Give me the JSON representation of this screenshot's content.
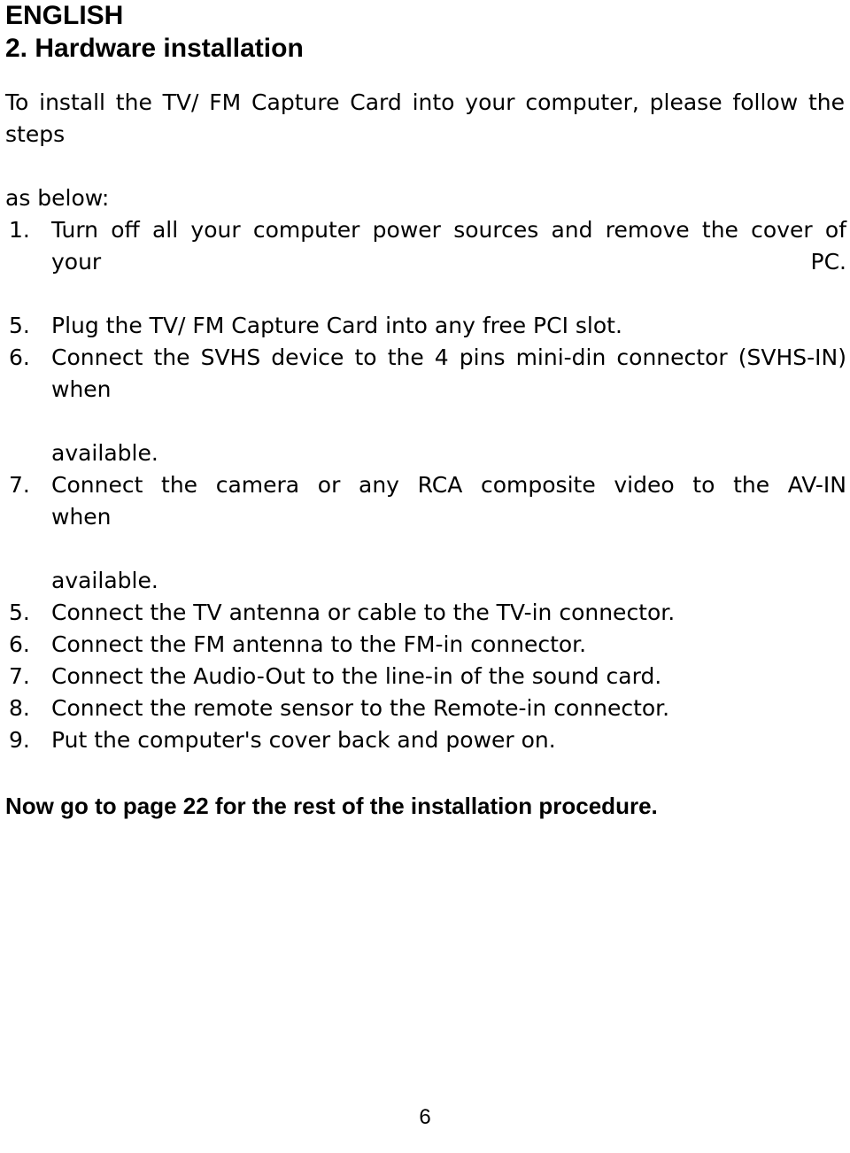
{
  "document": {
    "language_header": "ENGLISH",
    "section_heading": "2. Hardware installation",
    "intro": {
      "line1": "To install the TV/ FM Capture Card into your computer, please follow the steps",
      "line2": "as below:"
    },
    "steps": [
      {
        "marker": "1.",
        "text": "Turn off all your computer power sources and remove the cover of your PC.",
        "continuation": ""
      },
      {
        "marker": "5.",
        "text": "Plug the TV/ FM Capture Card into any free PCI slot.",
        "continuation": ""
      },
      {
        "marker": "6.",
        "text": "Connect the SVHS device to the 4 pins mini-din connector (SVHS-IN) when",
        "continuation": "available."
      },
      {
        "marker": "7.",
        "text": "Connect the camera or any RCA composite video to the AV-IN when",
        "continuation": "available."
      },
      {
        "marker": "5.",
        "text": "Connect the TV antenna or cable to the TV-in connector.",
        "continuation": ""
      },
      {
        "marker": "6.",
        "text": "Connect the FM antenna to the FM-in connector.",
        "continuation": ""
      },
      {
        "marker": "7.",
        "text": "Connect the Audio-Out to the line-in of the sound card.",
        "continuation": ""
      },
      {
        "marker": "8.",
        "text": "Connect the remote sensor to the Remote-in connector.",
        "continuation": ""
      },
      {
        "marker": "9.",
        "text": "Put the computer's cover back and power on.",
        "continuation": ""
      }
    ],
    "closing_line": "Now go to page 22 for the rest of the installation procedure.",
    "page_number": "6"
  },
  "colors": {
    "text": "#000000",
    "background": "#ffffff"
  }
}
